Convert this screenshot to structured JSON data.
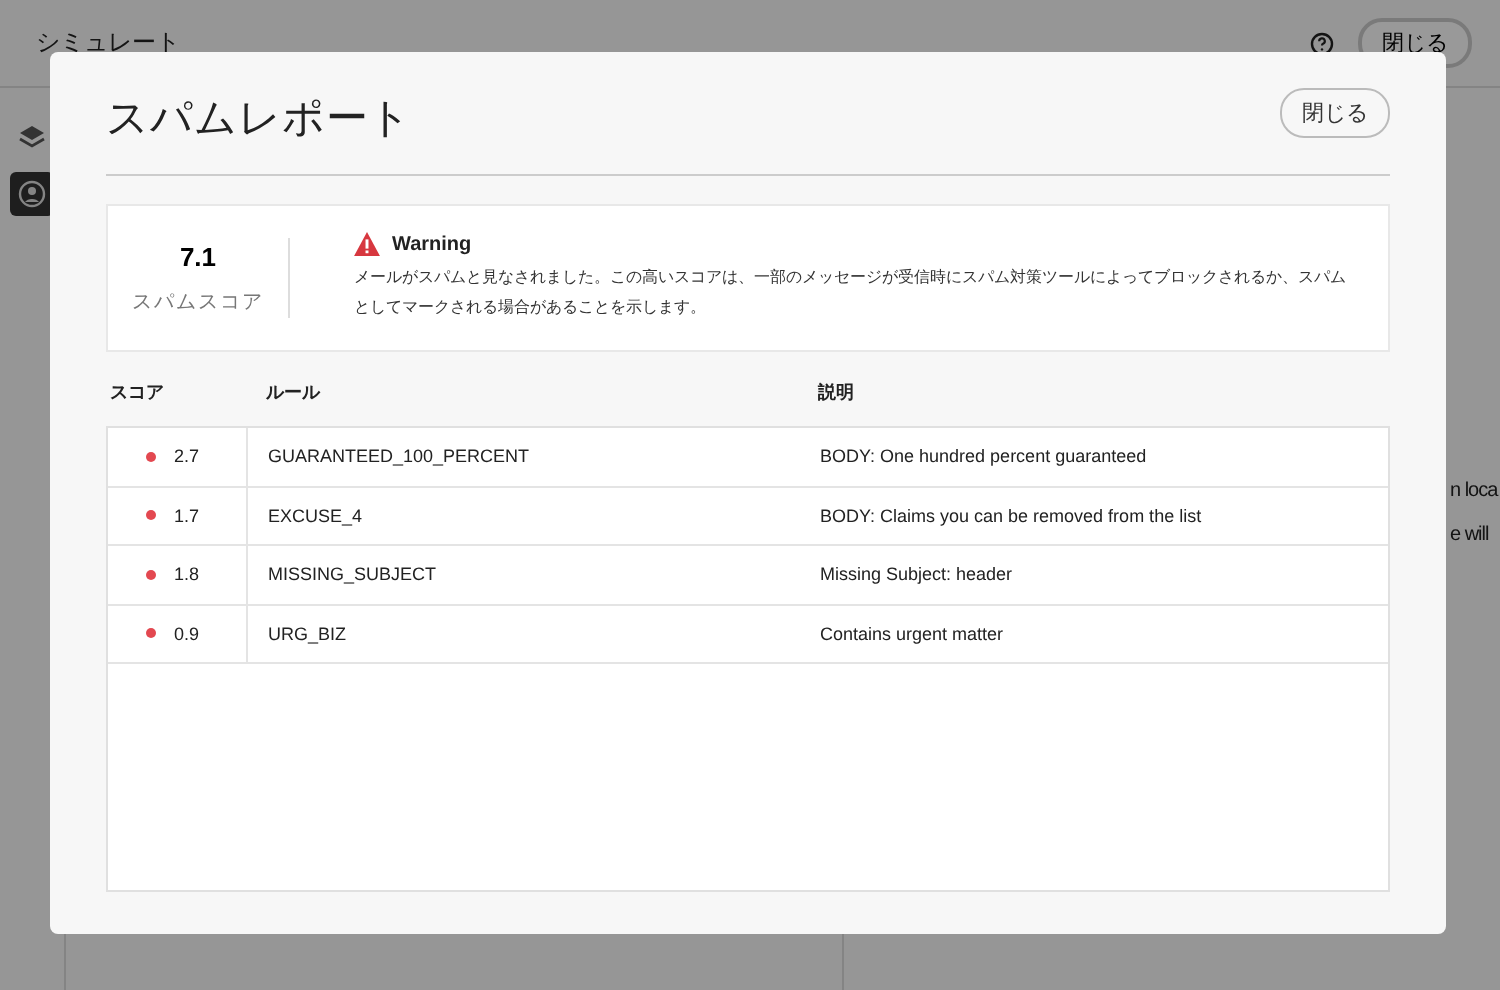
{
  "background": {
    "title": "シミュレート",
    "close_button": "閉じる",
    "text_fragments": [
      "n loca",
      "e will"
    ]
  },
  "dialog": {
    "title": "スパムレポート",
    "close_button": "閉じる",
    "score": {
      "value": "7.1",
      "label": "スパムスコア"
    },
    "warning": {
      "title": "Warning",
      "message": "メールがスパムと見なされました。この高いスコアは、一部のメッセージが受信時にスパム対策ツールによってブロックされるか、スパムとしてマークされる場合があることを示します。"
    },
    "table": {
      "columns": [
        "スコア",
        "ルール",
        "説明"
      ],
      "rows": [
        {
          "score": "2.7",
          "rule": "GUARANTEED_100_PERCENT",
          "description": "BODY: One hundred percent guaranteed",
          "color": "#e34850"
        },
        {
          "score": "1.7",
          "rule": "EXCUSE_4",
          "description": "BODY: Claims you can be removed from the list",
          "color": "#e34850"
        },
        {
          "score": "1.8",
          "rule": "MISSING_SUBJECT",
          "description": "Missing Subject: header",
          "color": "#e34850"
        },
        {
          "score": "0.9",
          "rule": "URG_BIZ",
          "description": "Contains urgent matter",
          "color": "#e34850"
        }
      ]
    }
  }
}
